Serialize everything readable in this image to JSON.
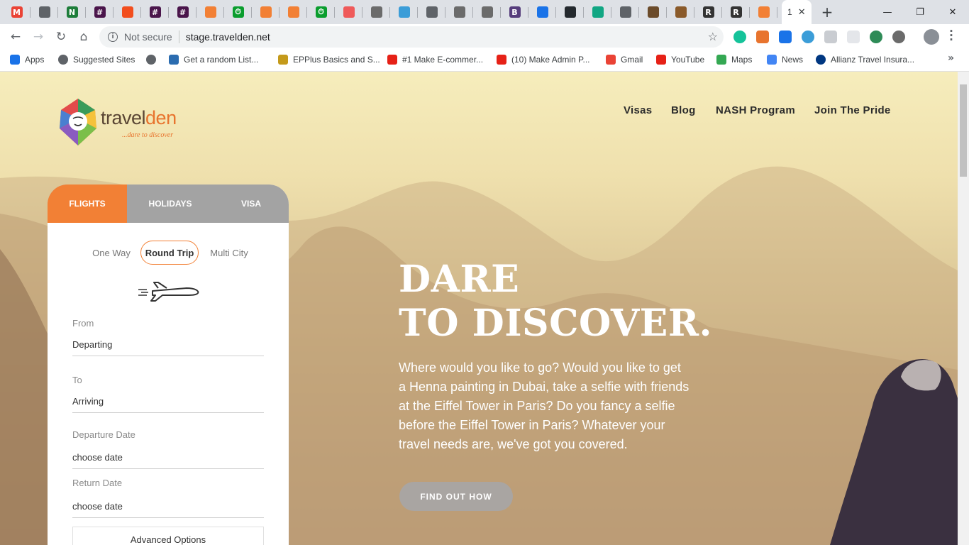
{
  "browser": {
    "tab_favicons": [
      {
        "icon": "gmail-icon",
        "color": "#ea4335",
        "glyph": "M"
      },
      {
        "icon": "globe-icon",
        "color": "#5f6368",
        "glyph": ""
      },
      {
        "icon": "spreadsheet-icon",
        "color": "#1d7d3a",
        "glyph": "N"
      },
      {
        "icon": "slack-icon",
        "color": "#4a154b",
        "glyph": "#"
      },
      {
        "icon": "figma-icon",
        "color": "#f24e1e",
        "glyph": ""
      },
      {
        "icon": "slack-icon",
        "color": "#4a154b",
        "glyph": "#"
      },
      {
        "icon": "slack-icon",
        "color": "#4a154b",
        "glyph": "#"
      },
      {
        "icon": "box-icon",
        "color": "#f28035",
        "glyph": ""
      },
      {
        "icon": "timer-icon",
        "color": "#0a9d2e",
        "glyph": "⏱"
      },
      {
        "icon": "box-icon",
        "color": "#f28035",
        "glyph": ""
      },
      {
        "icon": "box-icon",
        "color": "#f28035",
        "glyph": ""
      },
      {
        "icon": "timer-icon",
        "color": "#0a9d2e",
        "glyph": "⏱"
      },
      {
        "icon": "laravel-icon",
        "color": "#ef5a5a",
        "glyph": ""
      },
      {
        "icon": "shield-icon",
        "color": "#6b6b6b",
        "glyph": ""
      },
      {
        "icon": "edit-icon",
        "color": "#3b9dd8",
        "glyph": ""
      },
      {
        "icon": "globe-icon",
        "color": "#5f6368",
        "glyph": ""
      },
      {
        "icon": "shield-icon",
        "color": "#6b6b6b",
        "glyph": ""
      },
      {
        "icon": "shield-icon",
        "color": "#6b6b6b",
        "glyph": ""
      },
      {
        "icon": "bootstrap-icon",
        "color": "#563d7c",
        "glyph": "B"
      },
      {
        "icon": "shield-check-icon",
        "color": "#1a73e8",
        "glyph": ""
      },
      {
        "icon": "github-icon",
        "color": "#24292e",
        "glyph": ""
      },
      {
        "icon": "diamond-icon",
        "color": "#11a683",
        "glyph": ""
      },
      {
        "icon": "globe-icon",
        "color": "#5f6368",
        "glyph": ""
      },
      {
        "icon": "image-icon",
        "color": "#6b4b2a",
        "glyph": ""
      },
      {
        "icon": "image-icon",
        "color": "#8a5a2a",
        "glyph": ""
      },
      {
        "icon": "r-icon",
        "color": "#333333",
        "glyph": "R"
      },
      {
        "icon": "r-icon",
        "color": "#333333",
        "glyph": "R"
      },
      {
        "icon": "travelden-icon",
        "color": "#f28035",
        "glyph": ""
      }
    ],
    "active_tab_label": "1",
    "window_controls": {
      "minimize": "—",
      "restore": "❐",
      "close": "✕"
    },
    "nav": {
      "back": "←",
      "forward": "→",
      "reload": "↻",
      "home": "⌂"
    },
    "address": {
      "security": "Not secure",
      "url": "stage.travelden.net"
    },
    "bookmarks": [
      {
        "label": "Apps",
        "icon": "apps-icon",
        "color": "#1a73e8"
      },
      {
        "label": "Suggested Sites",
        "icon": "globe-icon",
        "color": "#5f6368"
      },
      {
        "label": "",
        "icon": "globe-icon",
        "color": "#5f6368"
      },
      {
        "label": "Get a random List...",
        "icon": "link-icon",
        "color": "#2b6cb0"
      },
      {
        "label": "EPPlus Basics and S...",
        "icon": "lightbulb-icon",
        "color": "#c49a1b"
      },
      {
        "label": "#1 Make E-commer...",
        "icon": "youtube-icon",
        "color": "#e62117"
      },
      {
        "label": "(10) Make Admin P...",
        "icon": "youtube-icon",
        "color": "#e62117"
      },
      {
        "label": "Gmail",
        "icon": "gmail-icon",
        "color": "#ea4335"
      },
      {
        "label": "YouTube",
        "icon": "youtube-icon",
        "color": "#e62117"
      },
      {
        "label": "Maps",
        "icon": "maps-icon",
        "color": "#34a853"
      },
      {
        "label": "News",
        "icon": "news-icon",
        "color": "#4285f4"
      },
      {
        "label": "Allianz Travel Insura...",
        "icon": "allianz-icon",
        "color": "#003781"
      }
    ],
    "bookmarks_more": "»"
  },
  "site": {
    "logo": {
      "brand_left": "travel",
      "brand_right": "den",
      "tagline": "...dare to discover"
    },
    "nav": [
      "Visas",
      "Blog",
      "NASH Program",
      "Join The Pride"
    ],
    "search": {
      "tabs": [
        "FLIGHTS",
        "HOLIDAYS",
        "VISA"
      ],
      "active_tab": "FLIGHTS",
      "trip_types": [
        "One Way",
        "Round Trip",
        "Multi City"
      ],
      "selected_trip": "Round Trip",
      "fields": [
        {
          "label": "From",
          "value": "Departing"
        },
        {
          "label": "To",
          "value": "Arriving"
        },
        {
          "label": "Departure Date",
          "value": "choose date"
        },
        {
          "label": "Return Date",
          "value": "choose date"
        }
      ],
      "advanced": "Advanced Options"
    },
    "hero": {
      "line1": "DARE",
      "line2": "TO DISCOVER.",
      "text": "Where would you like to go? Would you like to get a Henna painting in Dubai, take a selfie with friends at the Eiffel Tower in Paris? Do you fancy a selfie before the Eiffel Tower in Paris? Whatever your travel needs are, we've got you covered.",
      "cta": "FIND OUT HOW"
    },
    "colors": {
      "accent": "#f28035",
      "tab_inactive": "#a3a3a3"
    }
  }
}
